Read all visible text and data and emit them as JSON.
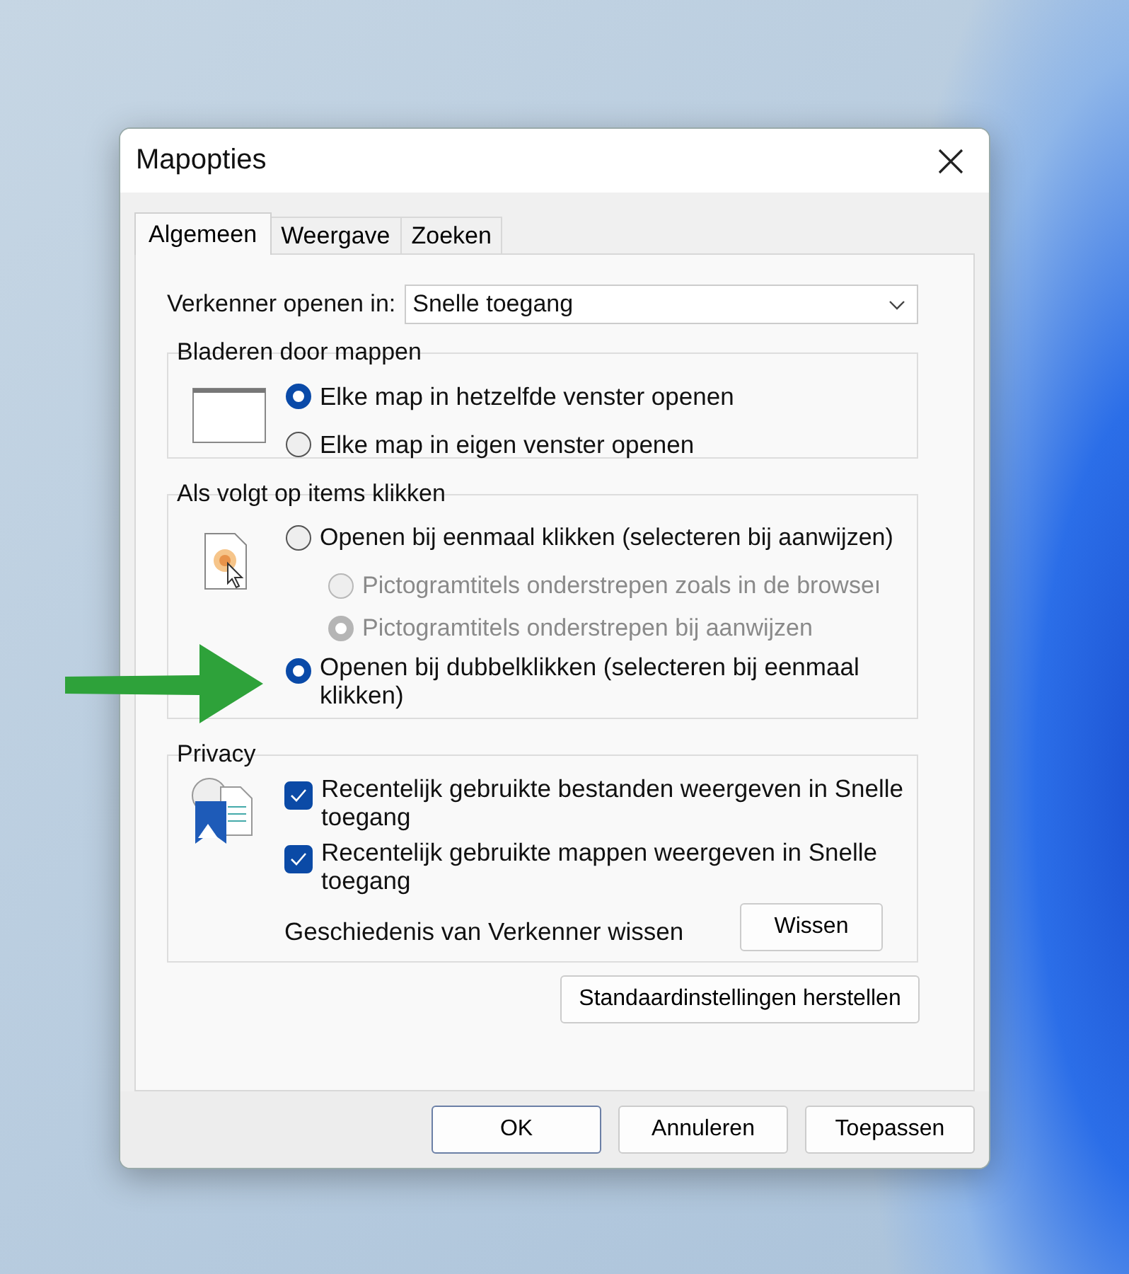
{
  "window": {
    "title": "Mapopties"
  },
  "tabs": [
    {
      "label": "Algemeen",
      "selected": true
    },
    {
      "label": "Weergave",
      "selected": false
    },
    {
      "label": "Zoeken",
      "selected": false
    }
  ],
  "open_in": {
    "label": "Verkenner openen in:",
    "value": "Snelle toegang"
  },
  "groups": [
    {
      "title": "Bladeren door mappen",
      "options": [
        {
          "kind": "radio",
          "label": "Elke map in hetzelfde venster openen",
          "selected": true,
          "disabled": false
        },
        {
          "kind": "radio",
          "label": "Elke map in eigen venster openen",
          "selected": false,
          "disabled": false
        }
      ]
    },
    {
      "title": "Als volgt op items klikken",
      "options": [
        {
          "kind": "radio",
          "label": "Openen bij eenmaal klikken (selecteren bij aanwijzen)",
          "selected": false,
          "disabled": false,
          "children": [
            {
              "kind": "radio",
              "label": "Pictogramtitels onderstrepen zoals in de browseı",
              "selected": false,
              "disabled": true
            },
            {
              "kind": "radio",
              "label": "Pictogramtitels onderstrepen bij aanwijzen",
              "selected": true,
              "disabled": true
            }
          ]
        },
        {
          "kind": "radio",
          "label": "Openen bij dubbelklikken (selecteren bij eenmaal klikken)",
          "selected": true,
          "disabled": false
        }
      ]
    },
    {
      "title": "Privacy",
      "options": [
        {
          "kind": "checkbox",
          "label": "Recentelijk gebruikte bestanden weergeven in Snelle toegang",
          "checked": true
        },
        {
          "kind": "checkbox",
          "label": "Recentelijk gebruikte mappen weergeven in Snelle toegang",
          "checked": true
        },
        {
          "kind": "action",
          "label": "Geschiedenis van Verkenner wissen",
          "button": "Wissen"
        }
      ]
    }
  ],
  "restore_button": "Standaardinstellingen herstellen",
  "footer_buttons": [
    {
      "label": "OK",
      "default": true
    },
    {
      "label": "Annuleren",
      "default": false
    },
    {
      "label": "Toepassen",
      "default": false
    }
  ]
}
